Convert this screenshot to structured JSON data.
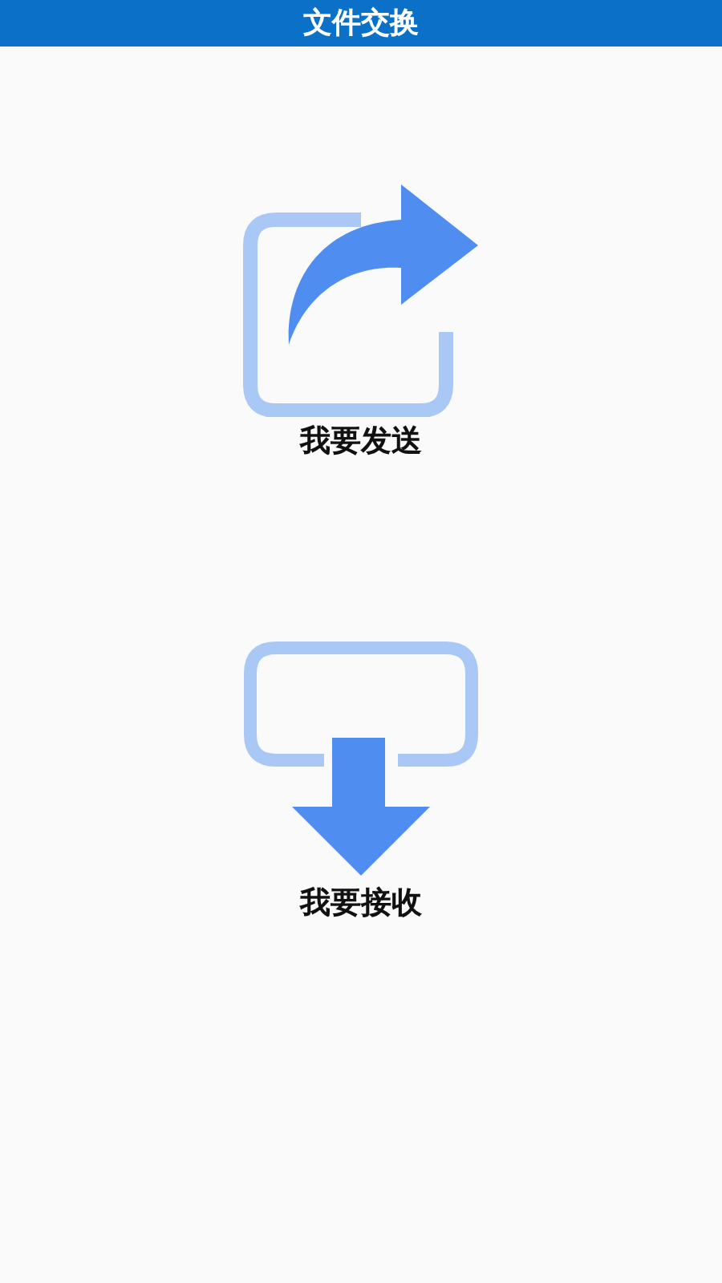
{
  "header": {
    "title": "文件交换"
  },
  "actions": [
    {
      "kind": "send",
      "label": "我要发送"
    },
    {
      "kind": "receive",
      "label": "我要接收"
    }
  ]
}
